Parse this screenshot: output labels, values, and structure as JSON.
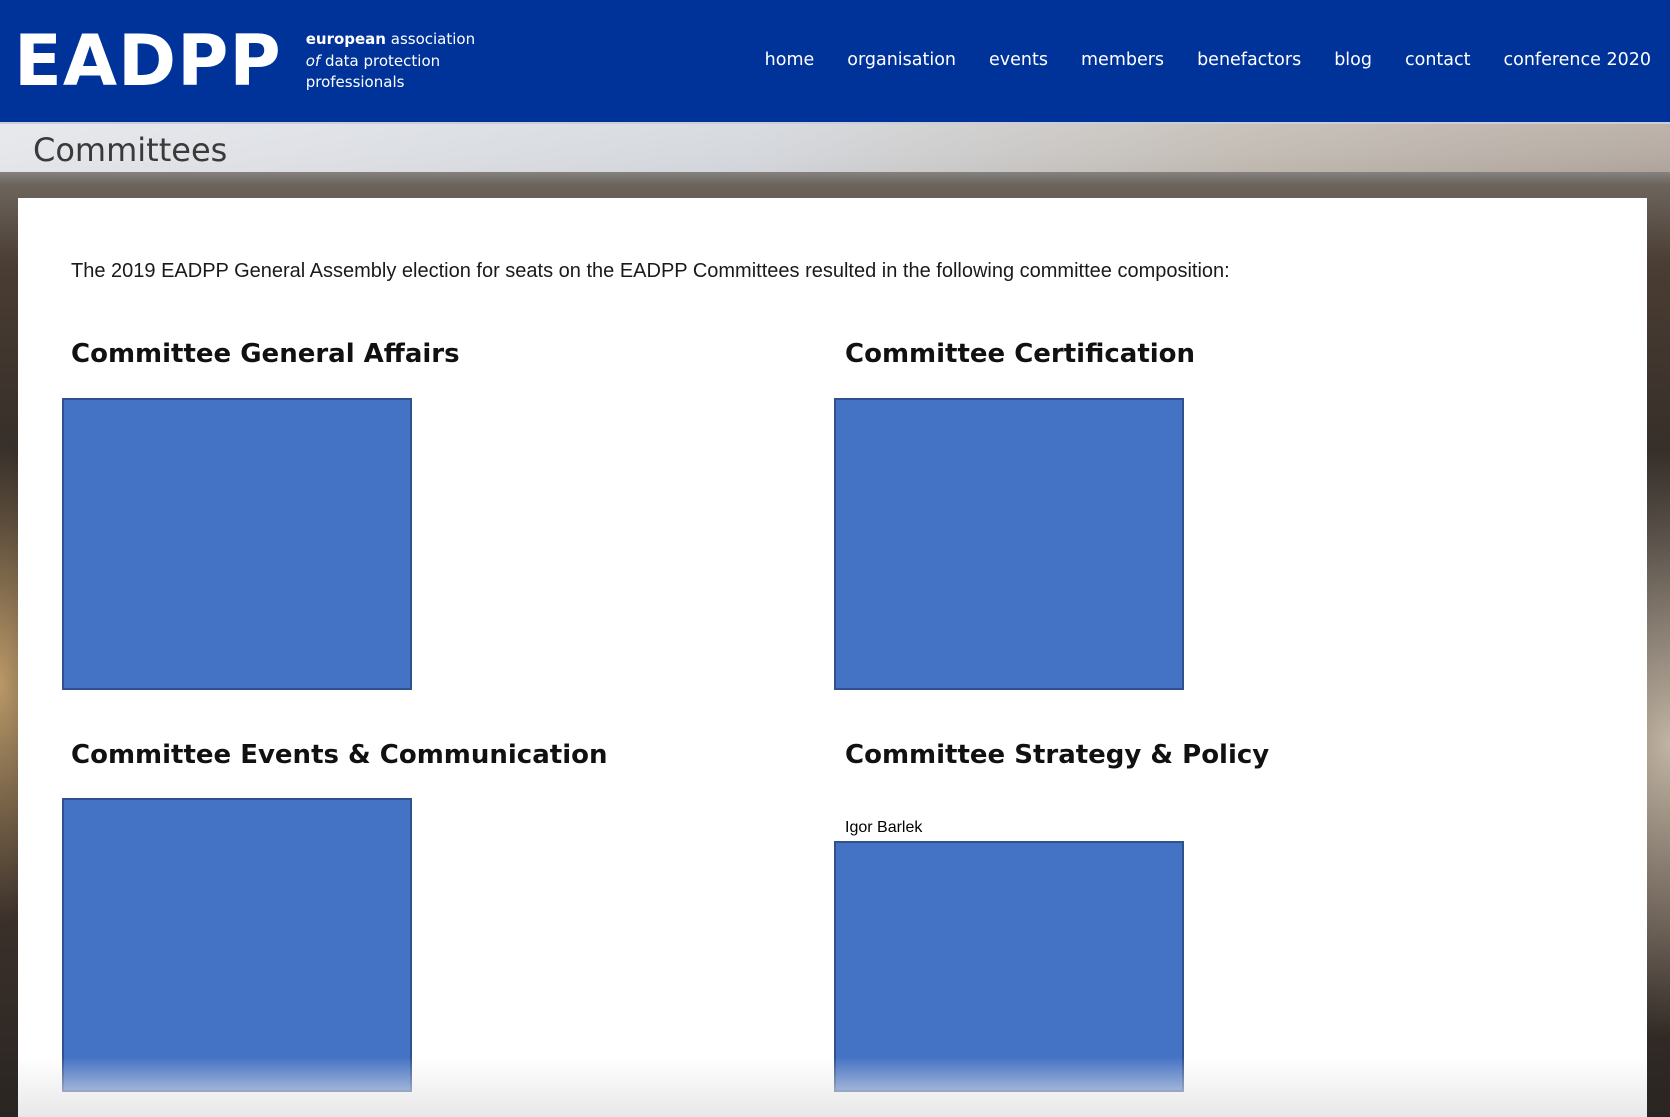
{
  "header": {
    "logo_text": "EADPP",
    "tagline": {
      "line1_bold": "european",
      "line1_rest": " association",
      "line2_italic": "of",
      "line2_rest": " data protection",
      "line3": "professionals"
    },
    "nav": [
      "home",
      "organisation",
      "events",
      "members",
      "benefactors",
      "blog",
      "contact",
      "conference 2020"
    ],
    "background_color": "#00339a"
  },
  "page": {
    "title": "Committees",
    "intro": "The 2019 EADPP General Assembly election for seats on the EADPP Committees resulted in the following committee composition:"
  },
  "committees": [
    {
      "heading": "Committee General Affairs",
      "member": ""
    },
    {
      "heading": "Committee Certification",
      "member": ""
    },
    {
      "heading": "Committee Events & Communication",
      "member": ""
    },
    {
      "heading": "Committee Strategy & Policy",
      "member": "Igor Barlek"
    }
  ],
  "colors": {
    "photo_placeholder": "#4472c4",
    "photo_border": "#2f528f"
  }
}
